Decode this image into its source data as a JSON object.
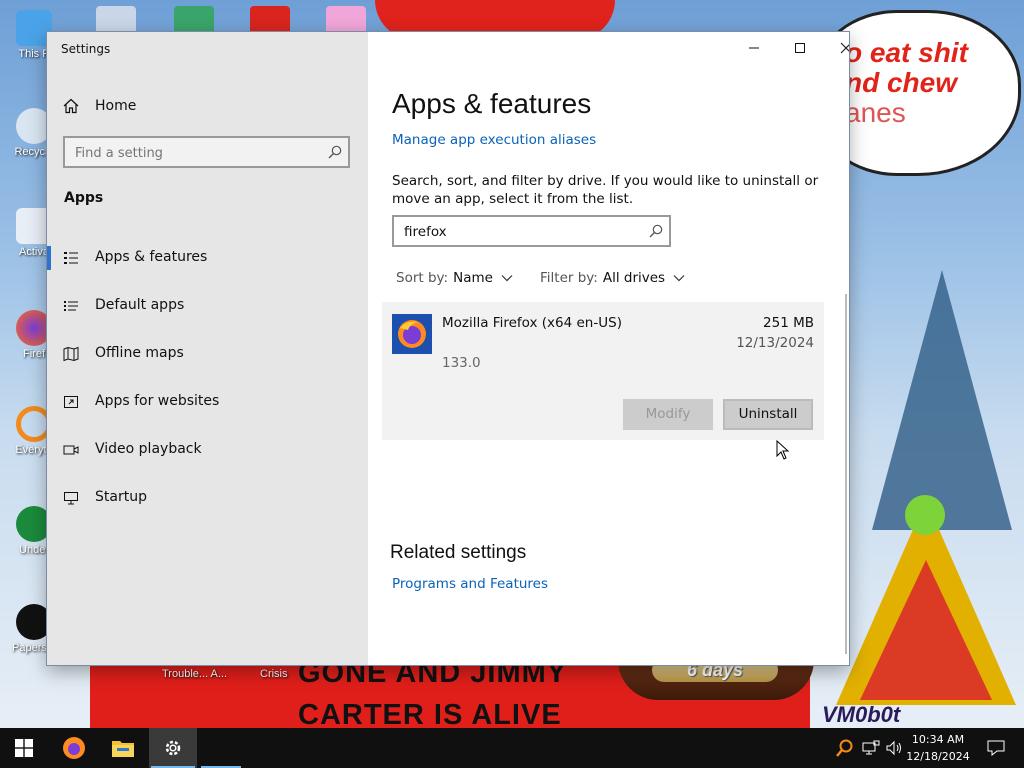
{
  "wallpaper": {
    "bubble_line1": "o eat shit",
    "bubble_line2": "nd chew",
    "bubble_line3": "anes",
    "banner_line1": "GONE AND JIMMY",
    "banner_line2": "CARTER IS ALIVE",
    "countdown_label": "6 days",
    "signature": "VM0b0t"
  },
  "desktop_icons": [
    {
      "label": "This P"
    },
    {
      "label": "Recycle"
    },
    {
      "label": "Activa"
    },
    {
      "label": "Firef"
    },
    {
      "label": "Everyth"
    },
    {
      "label": "Under"
    },
    {
      "label": "Papers, P"
    }
  ],
  "desktop_strip": {
    "trouble_label": "Trouble... A...",
    "crisis_label": "Crisis"
  },
  "window": {
    "title": "Settings",
    "sidebar": {
      "home_label": "Home",
      "search_placeholder": "Find a setting",
      "section_heading": "Apps",
      "items": [
        {
          "label": "Apps & features",
          "icon": "apps-features-icon",
          "active": true
        },
        {
          "label": "Default apps",
          "icon": "default-apps-icon",
          "active": false
        },
        {
          "label": "Offline maps",
          "icon": "offline-maps-icon",
          "active": false
        },
        {
          "label": "Apps for websites",
          "icon": "apps-websites-icon",
          "active": false
        },
        {
          "label": "Video playback",
          "icon": "video-playback-icon",
          "active": false
        },
        {
          "label": "Startup",
          "icon": "startup-icon",
          "active": false
        }
      ]
    },
    "main": {
      "title": "Apps & features",
      "manage_aliases_link": "Manage app execution aliases",
      "description": "Search, sort, and filter by drive. If you would like to uninstall or move an app, select it from the list.",
      "search_value": "firefox",
      "sort_label": "Sort by:",
      "sort_value": "Name",
      "filter_label": "Filter by:",
      "filter_value": "All drives",
      "app": {
        "name": "Mozilla Firefox (x64 en-US)",
        "size": "251 MB",
        "date": "12/13/2024",
        "version": "133.0",
        "modify_label": "Modify",
        "uninstall_label": "Uninstall"
      },
      "related_heading": "Related settings",
      "programs_link": "Programs and Features"
    }
  },
  "taskbar": {
    "time": "10:34 AM",
    "date": "12/18/2024"
  },
  "colors": {
    "accent": "#2a74d0",
    "link": "#0a63b8",
    "sidebar_bg": "#e6e6e6",
    "taskbar_bg": "#101010"
  }
}
